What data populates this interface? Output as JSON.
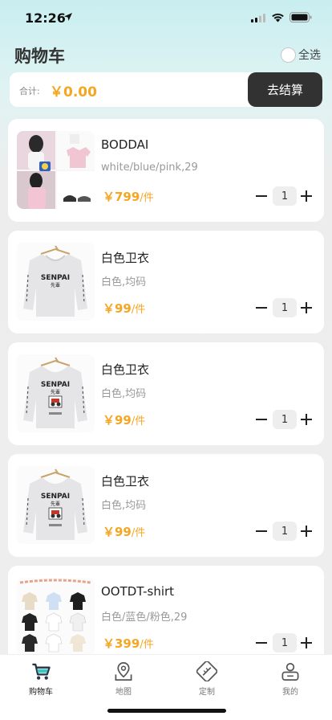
{
  "status": {
    "time": "12:26"
  },
  "header": {
    "title": "购物车",
    "select_all": "全选"
  },
  "summary": {
    "total_label": "合计:",
    "total_amount": "￥0.00",
    "checkout_label": "去结算"
  },
  "cart": {
    "items": [
      {
        "name": "BODDAI",
        "spec": "white/blue/pink,29",
        "price": "￥799",
        "unit": "/件",
        "qty": "1"
      },
      {
        "name": "白色卫衣",
        "spec": "白色,均码",
        "price": "￥99",
        "unit": "/件",
        "qty": "1"
      },
      {
        "name": "白色卫衣",
        "spec": "白色,均码",
        "price": "￥99",
        "unit": "/件",
        "qty": "1"
      },
      {
        "name": "白色卫衣",
        "spec": "白色,均码",
        "price": "￥99",
        "unit": "/件",
        "qty": "1"
      },
      {
        "name": "OOTDT-shirt",
        "spec": "白色/蓝色/粉色,29",
        "price": "￥399",
        "unit": "/件",
        "qty": "1"
      }
    ]
  },
  "hoodie_print": {
    "brand": "SENPAI",
    "sub": "先輩"
  },
  "tabbar": {
    "tabs": [
      {
        "label": "购物车",
        "icon": "cart-icon"
      },
      {
        "label": "地图",
        "icon": "map-icon"
      },
      {
        "label": "定制",
        "icon": "customize-icon"
      },
      {
        "label": "我的",
        "icon": "profile-icon"
      }
    ]
  },
  "colors": {
    "accent": "#f5a623",
    "checkout_bg": "#323232"
  }
}
